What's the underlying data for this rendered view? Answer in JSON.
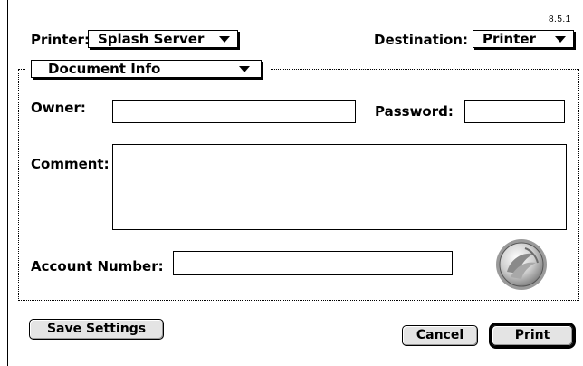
{
  "version": "8.5.1",
  "printer": {
    "label": "Printer:",
    "value": "Splash Server"
  },
  "destination": {
    "label": "Destination:",
    "value": "Printer"
  },
  "section": {
    "value": "Document Info"
  },
  "fields": {
    "owner_label": "Owner:",
    "owner_value": "",
    "password_label": "Password:",
    "password_value": "",
    "comment_label": "Comment:",
    "comment_value": "",
    "account_label": "Account Number:",
    "account_value": ""
  },
  "buttons": {
    "save_settings": "Save Settings",
    "cancel": "Cancel",
    "print": "Print"
  },
  "icons": {
    "logo": "splash-logo-icon",
    "popup_arrow": "triangle-down-icon"
  }
}
